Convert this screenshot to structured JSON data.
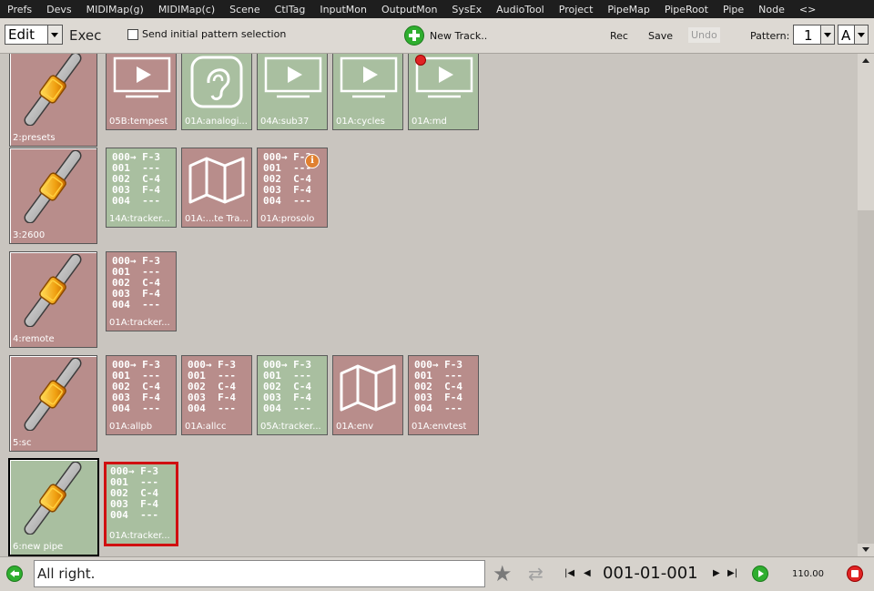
{
  "menubar": {
    "items": [
      "Prefs",
      "Devs",
      "MIDIMap(g)",
      "MIDIMap(c)",
      "Scene",
      "CtlTag",
      "InputMon",
      "OutputMon",
      "SysEx",
      "AudioTool",
      "Project",
      "PipeMap",
      "PipeRoot",
      "Pipe",
      "Node",
      "<>"
    ]
  },
  "toolbar": {
    "mode_value": "Edit",
    "exec_label": "Exec",
    "send_initial_label": "Send initial pattern selection",
    "new_track_label": "New Track..",
    "rec_label": "Rec",
    "save_label": "Save",
    "undo_label": "Undo",
    "pattern_label": "Pattern:",
    "pattern_number": "1",
    "pattern_letter": "A"
  },
  "tracker_text": "000→ F-3\n001  ---\n002  C-4\n003  F-4\n004  ---",
  "pipes": [
    {
      "label": "2:presets",
      "nodes": [
        {
          "label": "05B:tempest",
          "icon": "monitor-icon",
          "color": "pink"
        },
        {
          "label": "01A:analogi...",
          "icon": "ear-icon",
          "color": "green"
        },
        {
          "label": "04A:sub37",
          "icon": "monitor-icon",
          "color": "green"
        },
        {
          "label": "01A:cycles",
          "icon": "monitor-icon",
          "color": "green"
        },
        {
          "label": "01A:md",
          "icon": "monitor-icon",
          "color": "green",
          "badge": "record-dot"
        }
      ]
    },
    {
      "label": "3:2600",
      "nodes": [
        {
          "label": "14A:tracker...",
          "icon": "tracker",
          "color": "green"
        },
        {
          "label": "01A:...te Tra...",
          "icon": "map-icon",
          "color": "pink"
        },
        {
          "label": "01A:prosolo",
          "icon": "tracker",
          "color": "pink",
          "badge": "info"
        }
      ]
    },
    {
      "label": "4:remote",
      "nodes": [
        {
          "label": "01A:tracker...",
          "icon": "tracker",
          "color": "pink"
        }
      ]
    },
    {
      "label": "5:sc",
      "nodes": [
        {
          "label": "01A:allpb",
          "icon": "tracker",
          "color": "pink"
        },
        {
          "label": "01A:allcc",
          "icon": "tracker",
          "color": "pink"
        },
        {
          "label": "05A:tracker...",
          "icon": "tracker",
          "color": "green"
        },
        {
          "label": "01A:env",
          "icon": "map-icon",
          "color": "pink"
        },
        {
          "label": "01A:envtest",
          "icon": "tracker",
          "color": "pink"
        }
      ]
    },
    {
      "label": "6:new pipe",
      "selected": true,
      "nodes": [
        {
          "label": "01A:tracker...",
          "icon": "tracker",
          "color": "green",
          "active": true
        }
      ]
    }
  ],
  "status": {
    "message": "All right.",
    "position": "001-01-001",
    "tempo": "110.00"
  },
  "colors": {
    "pink_node": "#b88d8b",
    "green_node": "#a9bfa0",
    "active_border": "#d01010",
    "menubar_bg": "#1e1e1e"
  }
}
